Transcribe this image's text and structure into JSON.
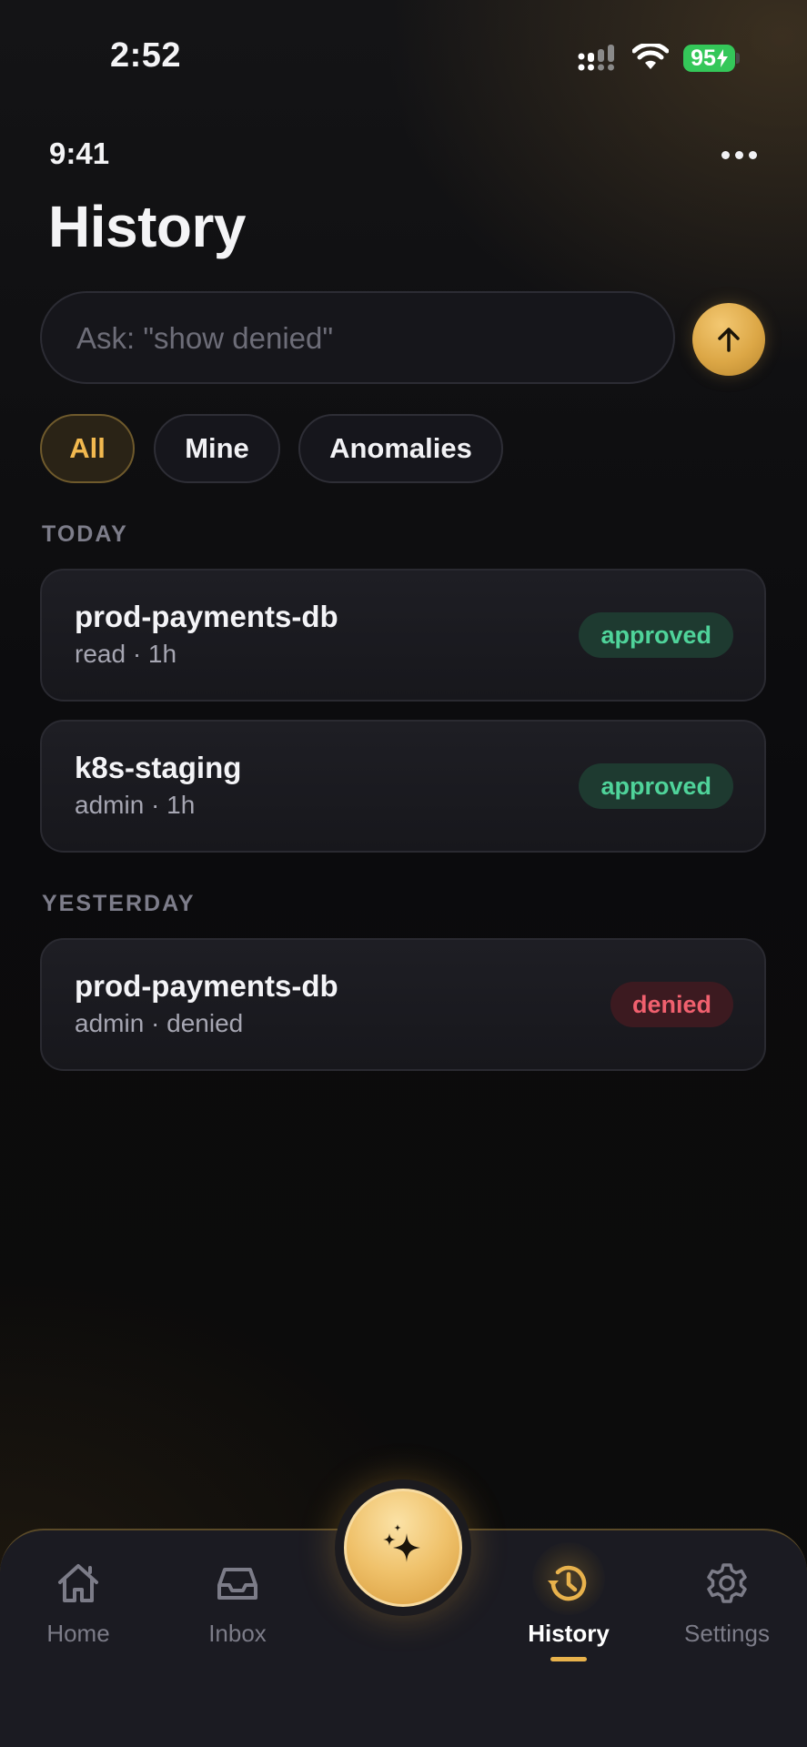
{
  "status_bar": {
    "time": "2:52",
    "battery": "95",
    "icons": [
      "cellular-signal-icon",
      "wifi-icon",
      "battery-charging-icon"
    ]
  },
  "header": {
    "time": "9:41",
    "title": "History",
    "more_icon": "ellipsis-icon"
  },
  "ask": {
    "placeholder": "Ask: \"show denied\"",
    "value": "",
    "send_icon": "arrow-up-icon"
  },
  "filters": [
    {
      "label": "All",
      "active": true
    },
    {
      "label": "Mine",
      "active": false
    },
    {
      "label": "Anomalies",
      "active": false
    }
  ],
  "sections": [
    {
      "label": "TODAY",
      "items": [
        {
          "title": "prod-payments-db",
          "subtitle": "read · 1h",
          "status": "approved"
        },
        {
          "title": "k8s-staging",
          "subtitle": "admin · 1h",
          "status": "approved"
        }
      ]
    },
    {
      "label": "YESTERDAY",
      "items": [
        {
          "title": "prod-payments-db",
          "subtitle": "admin · denied",
          "status": "denied"
        }
      ]
    }
  ],
  "tabbar": {
    "tabs": [
      {
        "label": "Home",
        "icon": "home-icon",
        "active": false
      },
      {
        "label": "Inbox",
        "icon": "inbox-icon",
        "active": false
      },
      {
        "label": "History",
        "icon": "history-icon",
        "active": true
      },
      {
        "label": "Settings",
        "icon": "gear-icon",
        "active": false
      }
    ],
    "center_icon": "sparkles-icon"
  },
  "colors": {
    "accent": "#e8b24c",
    "approved": "#4fd39a",
    "denied": "#f0606e",
    "battery": "#34c759"
  }
}
